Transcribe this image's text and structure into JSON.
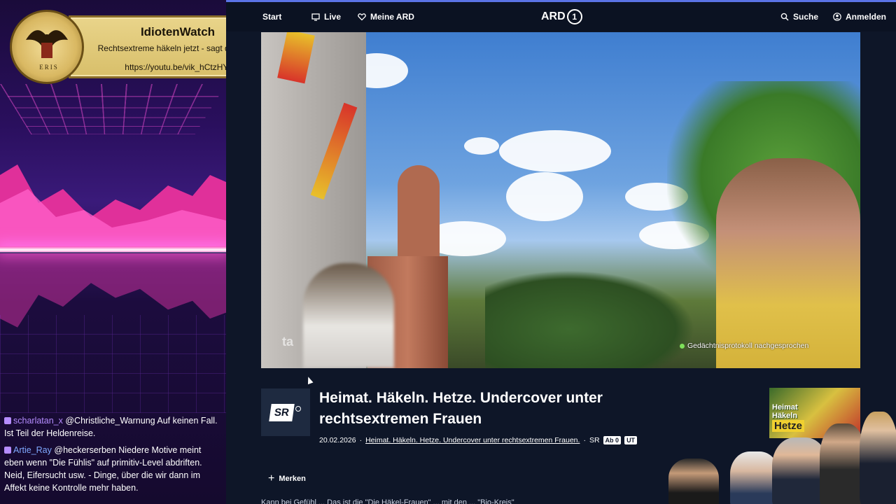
{
  "banner": {
    "title": "IdiotenWatch",
    "subtitle": "Rechtsextreme häkeln jetzt - sagt der ÖRR",
    "url": "https://youtu.be/vik_hCtzHYI",
    "emblem_text": "ERIS"
  },
  "chat": {
    "messages": [
      {
        "user": "scharlatan_x",
        "text": "@Christliche_Warnung Auf keinen Fall. Ist Teil der Heldenreise."
      },
      {
        "user": "Artie_Ray",
        "text": "@heckerserben Niedere Motive meint eben wenn \"Die Fühlis\" auf primitiv-Level abdriften. Neid, Eifersucht usw. - Dinge, über die wir dann im Affekt keine Kontrolle mehr haben."
      }
    ]
  },
  "nav": {
    "start_label": "Start",
    "live_label": "Live",
    "meine_label": "Meine ARD",
    "logo_text": "ARD",
    "logo_number": "1",
    "search_label": "Suche",
    "login_label": "Anmelden"
  },
  "video": {
    "watermark": "ta",
    "caption": "Gedächtnisprotokoll nachgesprochen"
  },
  "show": {
    "channel": "SR",
    "title": "Heimat. Häkeln. Hetze. Undercover unter rechtsextremen Frauen",
    "date": "20.02.2026",
    "link_text": "Heimat. Häkeln. Hetze. Undercover unter rechtsextremen Frauen.",
    "separator": "·",
    "channel_short": "SR",
    "badges": [
      "Ab 0",
      "UT"
    ],
    "merken_label": "Merken",
    "description_start": "Kann bei Gefühl ... Das ist die \"Die Häkel-Frauen\" ... mit den ... \"Bio-Kreis\""
  },
  "thumbnail": {
    "line1": "Heimat",
    "line2": "Häkeln",
    "line3": "Hetze"
  },
  "colors": {
    "ard_bg": "#0e1628",
    "accent_line": "#5a73e6",
    "banner_gold": "#e9d48a",
    "synthwave_pink": "#ff50dc"
  }
}
